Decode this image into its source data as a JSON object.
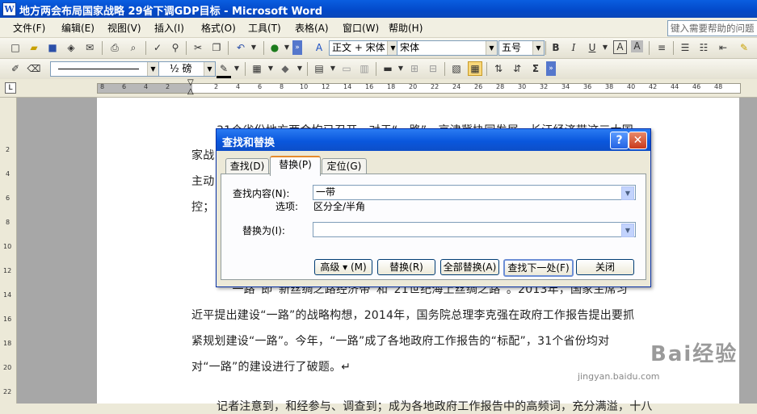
{
  "window": {
    "title": "地方两会布局国家战略 29省下调GDP目标 - Microsoft Word",
    "app_icon": "W"
  },
  "menubar": {
    "items": [
      "文件(F)",
      "编辑(E)",
      "视图(V)",
      "插入(I)",
      "格式(O)",
      "工具(T)",
      "表格(A)",
      "窗口(W)",
      "帮助(H)"
    ],
    "help_box": "键入需要帮助的问题"
  },
  "formatting": {
    "style": "正文 + 宋体",
    "font": "宋体",
    "size": "五号"
  },
  "drawing": {
    "line_weight": "½ 磅"
  },
  "ruler": {
    "numbers": [
      "8",
      "6",
      "4",
      "2",
      "2",
      "4",
      "6",
      "8",
      "10",
      "12",
      "14",
      "16",
      "18",
      "20",
      "22",
      "24",
      "26",
      "28",
      "30",
      "32",
      "34",
      "36",
      "38",
      "40",
      "42",
      "44",
      "46",
      "48"
    ]
  },
  "vruler": {
    "numbers": [
      "2",
      "4",
      "6",
      "8",
      "10",
      "12",
      "14",
      "16",
      "18",
      "20",
      "22"
    ]
  },
  "document": {
    "lines": [
      "31个省份地方两会均已召开，对于“一路”、京津冀协同发展、长江经济带这三大国",
      "家战",
      "主动",
      "控；",
      "“一路”即“新丝绸之路经济带”和“21世纪海上丝绸之路”。2013年，国家主席习",
      "近平提出建设“一路”的战略构想，2014年，国务院总理李克强在政府工作报告提出要抓",
      "紧规划建设“一路”。今年，“一路”成了各地政府工作报告的“标配”，31个省份均对",
      "对“一路”的建设进行了破题。↵",
      "记者注意到，和经参与、调查到；成为各地政府工作报告中的高频词，充分满溢，十八"
    ]
  },
  "dialog": {
    "title": "查找和替换",
    "help_glyph": "?",
    "close_glyph": "✕",
    "tabs": [
      "查找(D)",
      "替换(P)",
      "定位(G)"
    ],
    "find_label": "查找内容(N):",
    "find_value": "一带",
    "options_label": "选项:",
    "options_value": "区分全/半角",
    "replace_label": "替换为(I):",
    "replace_value": "",
    "buttons": {
      "advanced": "高级 ▾ (M)",
      "replace": "替换(R)",
      "replace_all": "全部替换(A)",
      "find_next": "查找下一处(F)",
      "close": "关闭"
    }
  },
  "watermark": {
    "text": "Bai经验",
    "url": "jingyan.baidu.com"
  }
}
